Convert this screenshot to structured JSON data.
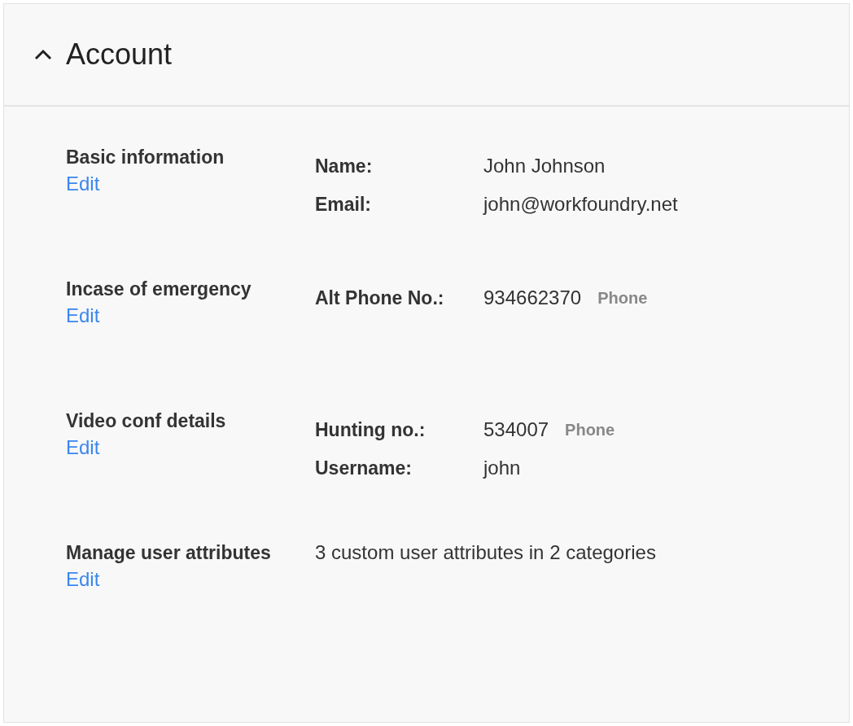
{
  "panel": {
    "title": "Account",
    "expanded": true
  },
  "sections": [
    {
      "kind": "fields",
      "label": "Basic information",
      "action": "Edit",
      "fields": [
        {
          "label": "Name:",
          "value": "John Johnson"
        },
        {
          "label": "Email:",
          "value": "john@workfoundry.net"
        }
      ]
    },
    {
      "kind": "fields",
      "label": "Incase of emergency",
      "action": "Edit",
      "fields": [
        {
          "label": "Alt Phone No.:",
          "value": "934662370",
          "tag": "Phone"
        }
      ]
    },
    {
      "kind": "fields",
      "label": "Video conf details",
      "action": "Edit",
      "fields": [
        {
          "label": "Hunting no.:",
          "value": "534007",
          "tag": "Phone"
        },
        {
          "label": "Username:",
          "value": "john"
        }
      ]
    },
    {
      "kind": "summary",
      "label": "Manage user attributes",
      "action": "Edit",
      "text": "3 custom user attributes in 2 categories"
    }
  ]
}
